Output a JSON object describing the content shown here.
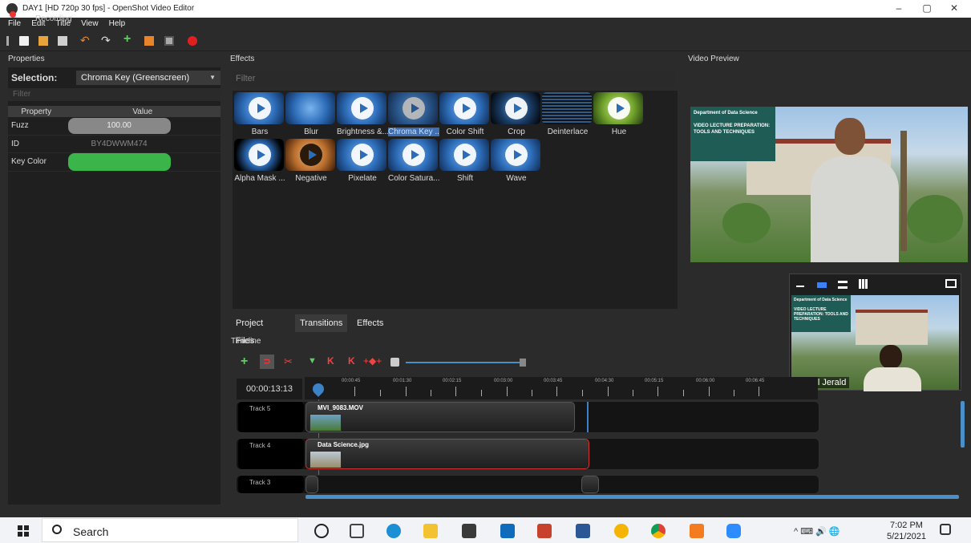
{
  "window": {
    "title": "DAY1 [HD 720p 30 fps] - OpenShot Video Editor",
    "recording_label": "Recording",
    "controls": [
      "–",
      "▢",
      "✕"
    ]
  },
  "menu": [
    "File",
    "Edit",
    "Title",
    "View",
    "Help"
  ],
  "panels": {
    "properties_title": "Properties",
    "effects_title": "Effects",
    "preview_title": "Video Preview",
    "timeline_title": "Timeline"
  },
  "properties": {
    "selection_label": "Selection:",
    "selection_value": "Chroma Key (Greenscreen)",
    "filter_placeholder": "Filter",
    "col_property": "Property",
    "col_value": "Value",
    "rows": [
      {
        "name": "Fuzz",
        "value": "100.00"
      },
      {
        "name": "ID",
        "value": "BY4DWWM474"
      },
      {
        "name": "Key Color",
        "value": ""
      }
    ],
    "key_color": "#3bb54a"
  },
  "effects": {
    "filter_placeholder": "Filter",
    "items": [
      "Bars",
      "Blur",
      "Brightness &...",
      "Chroma Key ...",
      "Color Shift",
      "Crop",
      "Deinterlace",
      "Hue",
      "Alpha Mask ...",
      "Negative",
      "Pixelate",
      "Color Satura...",
      "Shift",
      "Wave"
    ],
    "selected": "Chroma Key ..."
  },
  "tabs": [
    "Project Files",
    "Transitions",
    "Effects"
  ],
  "active_tab": "Transitions",
  "preview": {
    "banner_text": "Department of Data Science\n\nVIDEO LECTURE PREPARATION: TOOLS AND TECHNIQUES"
  },
  "camera": {
    "name": "Vimal Jerald",
    "banner_text": "Department of Data Science\n\nVIDEO LECTURE PREPARATION: TOOLS AND TECHNIQUES"
  },
  "timeline": {
    "timecode": "00:00:13:13",
    "ruler_labels": [
      "00:00:45",
      "00:01:30",
      "00:02:15",
      "00:03:00",
      "00:03:45",
      "00:04:30",
      "00:05:15",
      "00:06:00",
      "00:06:45"
    ],
    "tracks": [
      {
        "name": "Track 5",
        "clip": "MVI_9083.MOV"
      },
      {
        "name": "Track 4",
        "clip": "Data Science.jpg"
      },
      {
        "name": "Track 3",
        "clip": ""
      }
    ]
  },
  "taskbar": {
    "search_placeholder": "Search",
    "time": "7:02 PM",
    "date": "5/21/2021",
    "tray": "^ ⌨ 🔊 🌐"
  }
}
